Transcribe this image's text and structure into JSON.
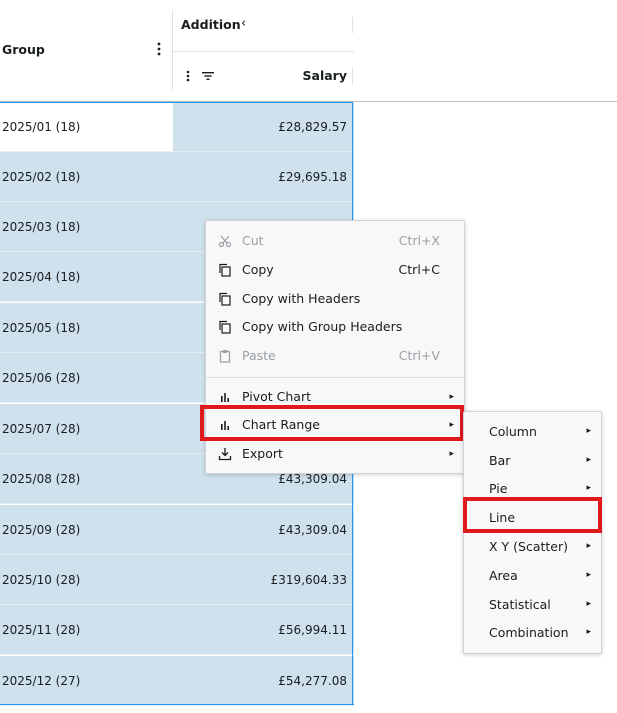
{
  "header": {
    "group_label": "Group",
    "addition_label": "Addition",
    "collapse_glyph": "‹",
    "salary_label": "Salary"
  },
  "rows": [
    {
      "group": "2025/01 (18)",
      "salary": "£28,829.57"
    },
    {
      "group": "2025/02 (18)",
      "salary": "£29,695.18"
    },
    {
      "group": "2025/03 (18)",
      "salary": ""
    },
    {
      "group": "2025/04 (18)",
      "salary": ""
    },
    {
      "group": "2025/05 (18)",
      "salary": ""
    },
    {
      "group": "2025/06 (28)",
      "salary": ""
    },
    {
      "group": "2025/07 (28)",
      "salary": ""
    },
    {
      "group": "2025/08 (28)",
      "salary": "£43,309.04"
    },
    {
      "group": "2025/09 (28)",
      "salary": "£43,309.04"
    },
    {
      "group": "2025/10 (28)",
      "salary": "£319,604.33"
    },
    {
      "group": "2025/11 (28)",
      "salary": "£56,994.11"
    },
    {
      "group": "2025/12 (27)",
      "salary": "£54,277.08"
    }
  ],
  "context_menu": {
    "items": [
      {
        "label": "Cut",
        "shortcut": "Ctrl+X",
        "icon": "cut-icon",
        "disabled": true
      },
      {
        "label": "Copy",
        "shortcut": "Ctrl+C",
        "icon": "copy-icon",
        "disabled": false
      },
      {
        "label": "Copy with Headers",
        "shortcut": "",
        "icon": "copy-icon",
        "disabled": false
      },
      {
        "label": "Copy with Group Headers",
        "shortcut": "",
        "icon": "copy-icon",
        "disabled": false
      },
      {
        "label": "Paste",
        "shortcut": "Ctrl+V",
        "icon": "paste-icon",
        "disabled": true
      },
      {
        "label": "Pivot Chart",
        "shortcut": "",
        "icon": "chart-icon",
        "disabled": false,
        "submenu": true
      },
      {
        "label": "Chart Range",
        "shortcut": "",
        "icon": "chart-icon",
        "disabled": false,
        "submenu": true
      },
      {
        "label": "Export",
        "shortcut": "",
        "icon": "export-icon",
        "disabled": false,
        "submenu": true
      }
    ]
  },
  "chart_submenu": {
    "items": [
      {
        "label": "Column",
        "submenu": true
      },
      {
        "label": "Bar",
        "submenu": true
      },
      {
        "label": "Pie",
        "submenu": true
      },
      {
        "label": "Line",
        "submenu": false
      },
      {
        "label": "X Y (Scatter)",
        "submenu": true
      },
      {
        "label": "Area",
        "submenu": true
      },
      {
        "label": "Statistical",
        "submenu": true
      },
      {
        "label": "Combination",
        "submenu": true
      }
    ]
  },
  "colors": {
    "selection": "#cfe1ed",
    "range_border": "#2196f3",
    "highlight_box": "#e0191d",
    "menu_bg": "#f8f8f8"
  },
  "submenu_arrow": "▸"
}
